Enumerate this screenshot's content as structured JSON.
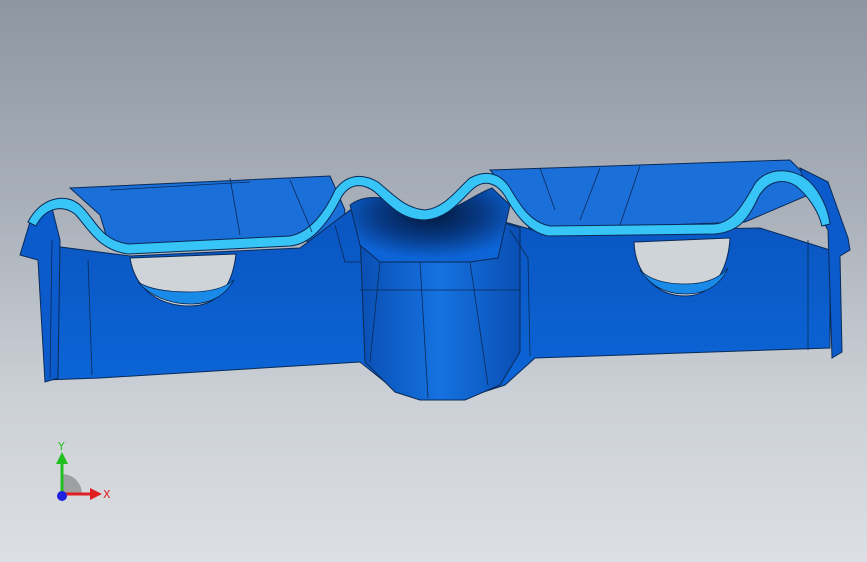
{
  "viewport": {
    "background_top": "#8e96a2",
    "background_bottom": "#dcdfe3"
  },
  "model": {
    "body_color": "#0d64d6",
    "edge_color": "#0a2a57",
    "cut_face_color": "#37c4f6",
    "shadow_color": "#02183c"
  },
  "triad": {
    "x_label": "X",
    "y_label": "Y",
    "x_color": "#e02020",
    "y_color": "#20c020",
    "z_color": "#2020e0"
  }
}
